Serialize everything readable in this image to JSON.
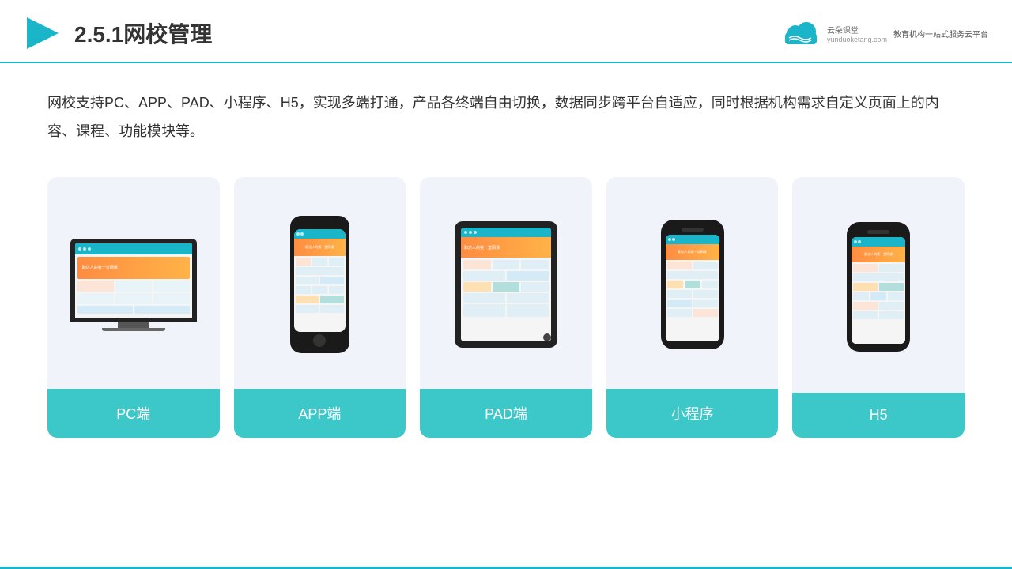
{
  "header": {
    "title": "2.5.1网校管理",
    "logo_name": "云朵课堂",
    "logo_url": "yunduoketang.com",
    "logo_tagline": "教育机构一站式服务云平台"
  },
  "description": {
    "text": "网校支持PC、APP、PAD、小程序、H5，实现多端打通，产品各终端自由切换，数据同步跨平台自适应，同时根据机构需求自定义页面上的内容、课程、功能模块等。"
  },
  "cards": [
    {
      "id": "pc",
      "label": "PC端"
    },
    {
      "id": "app",
      "label": "APP端"
    },
    {
      "id": "pad",
      "label": "PAD端"
    },
    {
      "id": "miniprogram",
      "label": "小程序"
    },
    {
      "id": "h5",
      "label": "H5"
    }
  ],
  "accent_color": "#3cc8c8",
  "border_color": "#1ab5c8"
}
